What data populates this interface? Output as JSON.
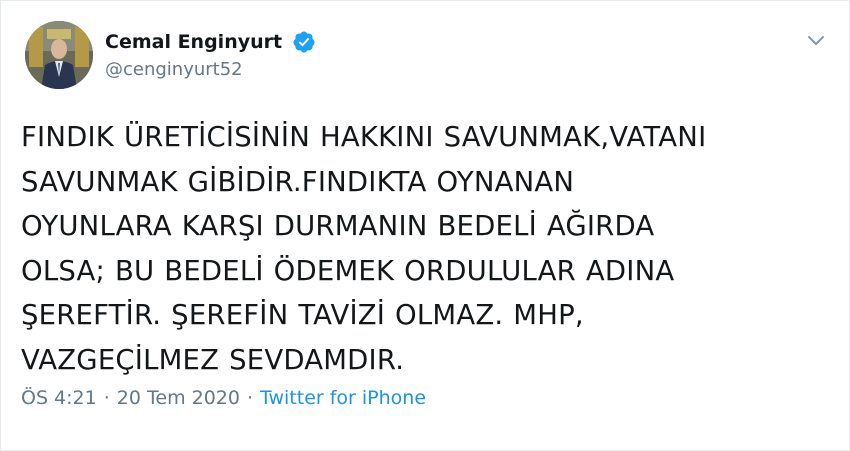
{
  "user": {
    "display_name": "Cemal Enginyurt",
    "username": "@cenginyurt52",
    "verified_icon": "verified-badge-icon",
    "avatar": "profile-photo"
  },
  "tweet": {
    "lines": [
      "FINDIK ÜRETİCİSİNİN HAKKINI SAVUNMAK,VATANI",
      "SAVUNMAK GİBİDİR.FINDIKTA OYNANAN",
      "OYUNLARA KARŞI DURMANIN BEDELİ AĞIRDA",
      "OLSA; BU BEDELİ ÖDEMEK ORDULULAR ADINA",
      "ŞEREFTİR. ŞEREFİN TAVİZİ OLMAZ. MHP,",
      "VAZGEÇİLMEZ SEVDAMDIR."
    ],
    "time": "ÖS 4:21",
    "separator": "·",
    "date": "20 Tem 2020",
    "source": "Twitter for iPhone"
  },
  "colors": {
    "text": "#14171a",
    "muted": "#657786",
    "link": "#1b95e0",
    "verified": "#1da1f2"
  },
  "icons": {
    "menu": "chevron-down-icon"
  }
}
